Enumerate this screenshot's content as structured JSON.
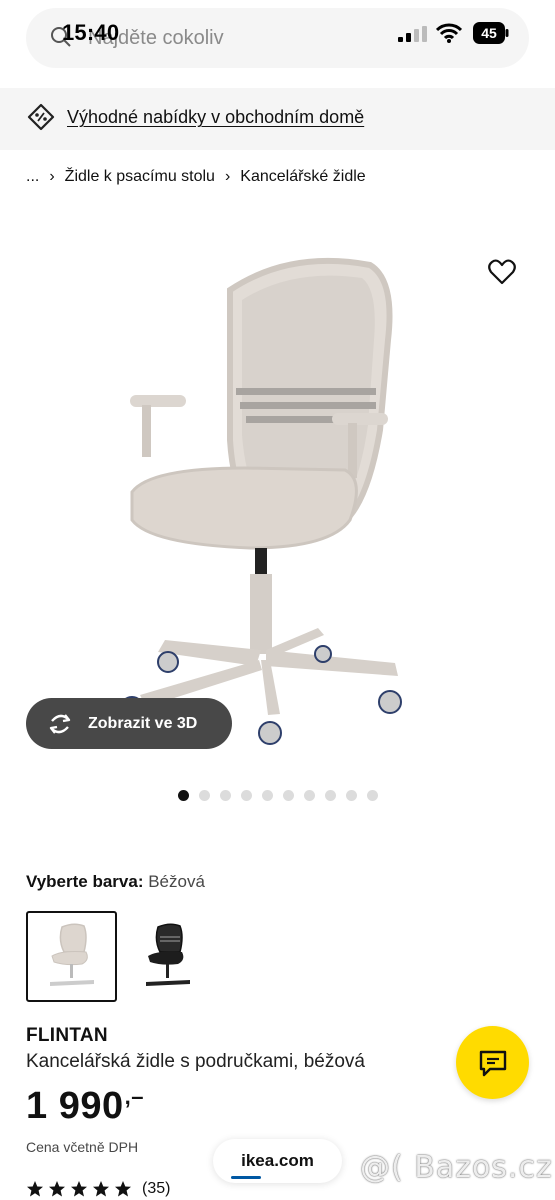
{
  "status_bar": {
    "time": "15:40",
    "battery": "45"
  },
  "search": {
    "placeholder": "Najděte cokoliv"
  },
  "offers": {
    "label": "Výhodné nabídky v obchodním domě"
  },
  "breadcrumb": {
    "ellipsis": "...",
    "items": [
      "Židle k psacímu stolu",
      "Kancelářské židle"
    ]
  },
  "view3d": {
    "label": "Zobrazit ve 3D"
  },
  "carousel": {
    "total": 10,
    "active": 0
  },
  "color_select": {
    "prefix": "Vyberte barva:",
    "value": "Béžová"
  },
  "product": {
    "name": "FLINTAN",
    "description": "Kancelářská židle s područkami, béžová",
    "price_main": "1 990",
    "price_suffix": ",–",
    "price_note": "Cena včetně DPH",
    "rating": 5,
    "review_count": "(35)"
  },
  "browser": {
    "url": "ikea.com"
  },
  "watermark": "@( Bazos.cz",
  "colors": {
    "accent_yellow": "#ffdb00",
    "dark_pill": "#484848",
    "link_blue": "#0058a3"
  }
}
